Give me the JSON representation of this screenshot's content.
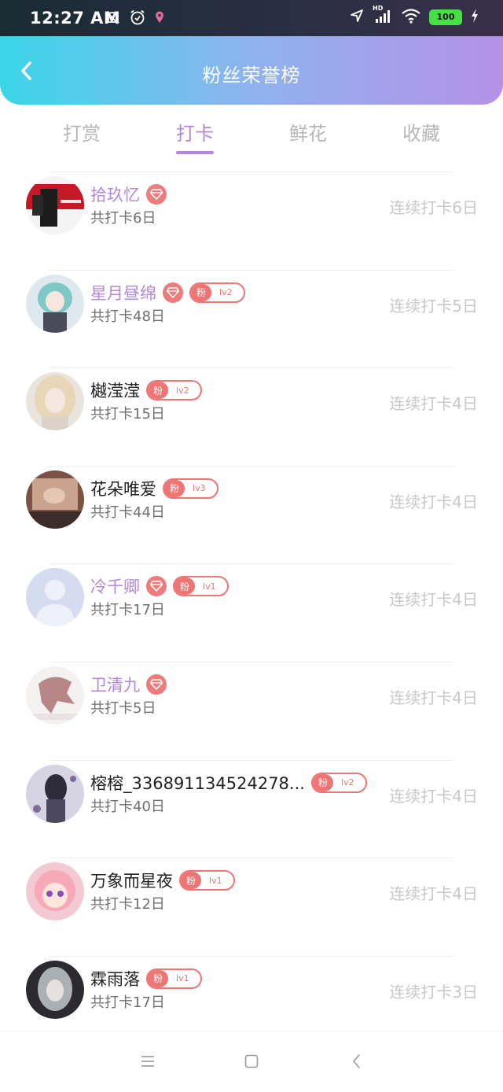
{
  "status_bar": {
    "time": "12:27 AM",
    "battery": "100",
    "icons_left": [
      "mute-bell-icon",
      "alarm-icon",
      "location-pin-icon"
    ],
    "icons_right": [
      "navigation-icon",
      "signal-icon",
      "wifi-icon",
      "battery-icon",
      "charging-icon"
    ],
    "signal_label": "HD"
  },
  "header": {
    "title": "粉丝荣誉榜",
    "back_icon": "chevron-left-icon"
  },
  "tabs": [
    {
      "label": "打赏",
      "active": false
    },
    {
      "label": "打卡",
      "active": true
    },
    {
      "label": "鲜花",
      "active": false
    },
    {
      "label": "收藏",
      "active": false
    }
  ],
  "fans": [
    {
      "name": "拾玖忆",
      "vip": true,
      "diamond": true,
      "fan_label": "",
      "level": "",
      "total": "共打卡6日",
      "streak": "连续打卡6日"
    },
    {
      "name": "星月昼绵",
      "vip": true,
      "diamond": true,
      "fan_label": "粉",
      "level": "lv2",
      "total": "共打卡48日",
      "streak": "连续打卡5日"
    },
    {
      "name": "樾滢滢",
      "vip": false,
      "diamond": false,
      "fan_label": "粉",
      "level": "lv2",
      "total": "共打卡15日",
      "streak": "连续打卡4日"
    },
    {
      "name": "花朵唯爱",
      "vip": false,
      "diamond": false,
      "fan_label": "粉",
      "level": "lv3",
      "total": "共打卡44日",
      "streak": "连续打卡4日"
    },
    {
      "name": "冷千卿",
      "vip": true,
      "diamond": true,
      "fan_label": "粉",
      "level": "lv1",
      "total": "共打卡17日",
      "streak": "连续打卡4日"
    },
    {
      "name": "卫清九",
      "vip": true,
      "diamond": true,
      "fan_label": "",
      "level": "",
      "total": "共打卡5日",
      "streak": "连续打卡4日"
    },
    {
      "name": "榕榕_336891134524278...",
      "vip": false,
      "diamond": false,
      "fan_label": "粉",
      "level": "lv2",
      "total": "共打卡40日",
      "streak": "连续打卡4日"
    },
    {
      "name": "万象而星夜",
      "vip": false,
      "diamond": false,
      "fan_label": "粉",
      "level": "lv1",
      "total": "共打卡12日",
      "streak": "连续打卡4日"
    },
    {
      "name": "霖雨落",
      "vip": false,
      "diamond": false,
      "fan_label": "粉",
      "level": "lv1",
      "total": "共打卡17日",
      "streak": "连续打卡3日"
    }
  ],
  "colors": {
    "accent": "#b487d8",
    "badge": "#ef7474",
    "gradient_start": "#3ad6e8",
    "gradient_end": "#b491e8"
  },
  "nav": [
    "menu-icon",
    "home-square-icon",
    "back-triangle-icon"
  ]
}
